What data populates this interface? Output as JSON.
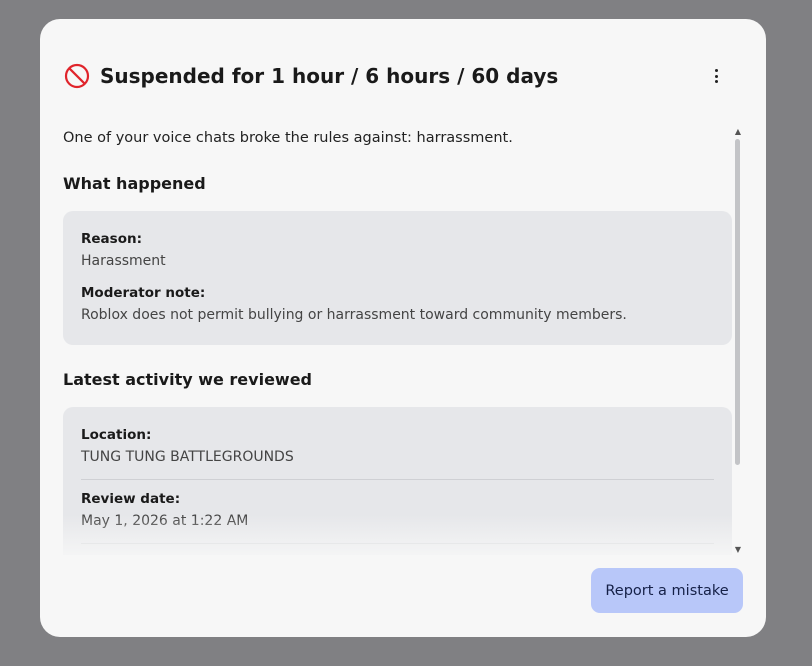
{
  "header": {
    "title": "Suspended for 1 hour / 6 hours / 60 days"
  },
  "content": {
    "intro": "One of your voice chats broke the rules against: harrassment.",
    "what_happened": {
      "title": "What happened",
      "reason_label": "Reason:",
      "reason_value": "Harassment",
      "note_label": "Moderator note:",
      "note_value": "Roblox does not permit bullying or harrassment toward community members."
    },
    "latest_activity": {
      "title": "Latest activity we reviewed",
      "location_label": "Location:",
      "location_value": "TUNG TUNG BATTLEGROUNDS",
      "date_label": "Review date:",
      "date_value": "May 1, 2026 at 1:22 AM"
    }
  },
  "footer": {
    "report_label": "Report a mistake"
  },
  "colors": {
    "ban_icon": "#e0242b",
    "primary_button": "#b8c7f9",
    "card_bg": "#e6e7ea"
  },
  "icons": {
    "status": "ban-icon",
    "menu": "more-vertical-icon"
  }
}
